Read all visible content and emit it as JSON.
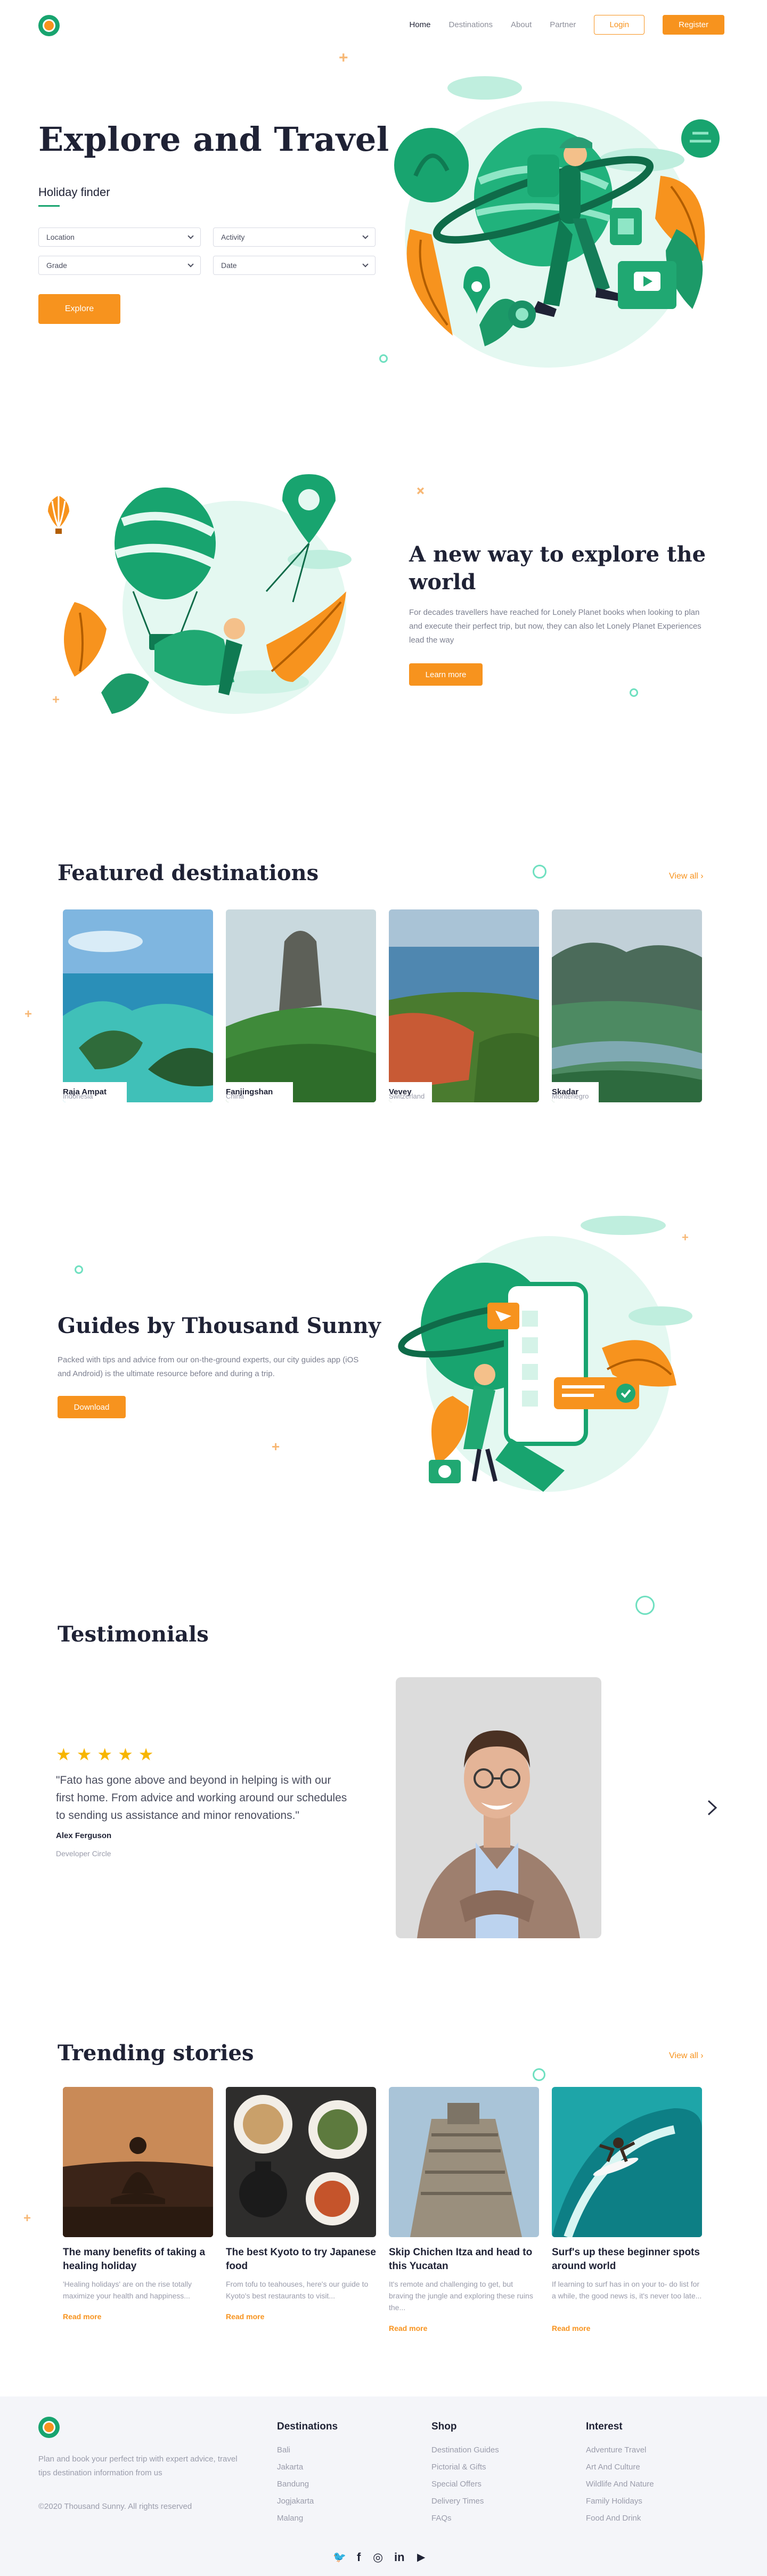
{
  "nav": {
    "items": [
      "Home",
      "Destinations",
      "About",
      "Partner"
    ],
    "login": "Login",
    "register": "Register"
  },
  "hero": {
    "title": "Explore and Travel",
    "finder_title": "Holiday finder",
    "selects": [
      "Location",
      "Activity",
      "Grade",
      "Date"
    ],
    "explore": "Explore"
  },
  "about": {
    "title": "A new way to explore the world",
    "text": "For decades travellers have reached for Lonely Planet books when looking to plan and execute their perfect trip, but now, they can also let Lonely Planet Experiences lead the way",
    "button": "Learn more"
  },
  "featured": {
    "title": "Featured destinations",
    "view_all": "View all",
    "items": [
      {
        "name": "Raja Ampat",
        "country": "Indonesia"
      },
      {
        "name": "Fanjingshan",
        "country": "China"
      },
      {
        "name": "Vevey",
        "country": "Switzerland"
      },
      {
        "name": "Skadar",
        "country": "Montenegro"
      }
    ]
  },
  "guides": {
    "title": "Guides by Thousand Sunny",
    "text": "Packed with tips and advice from our on-the-ground experts, our city guides app (iOS and Android) is the ultimate resource before and during a trip.",
    "button": "Download"
  },
  "testimonials": {
    "title": "Testimonials",
    "rating": 5,
    "quote": "\"Fato has gone above and beyond in helping is with our first home. From advice and working around our schedules to sending us assistance and minor renovations.\"",
    "author": "Alex Ferguson",
    "role": "Developer Circle"
  },
  "trending": {
    "title": "Trending stories",
    "view_all": "View all",
    "read_more": "Read more",
    "items": [
      {
        "title": "The many benefits of taking a healing holiday",
        "text": "'Healing holidays' are on the rise totally maximize your health and happiness..."
      },
      {
        "title": "The best Kyoto to try Japanese food",
        "text": "From tofu to teahouses, here's our guide to Kyoto's best restaurants to visit..."
      },
      {
        "title": "Skip Chichen Itza and head to this Yucatan",
        "text": "It's remote and challenging to get, but braving the jungle and exploring these ruins the..."
      },
      {
        "title": "Surf's up these beginner spots around world",
        "text": "If learning to surf has in on your to- do list for a while, the good news is, it's never too late..."
      }
    ]
  },
  "footer": {
    "about": "Plan and book your perfect trip with expert advice, travel tips destination information from us",
    "copyright": "©2020 Thousand Sunny. All rights reserved",
    "columns": [
      {
        "title": "Destinations",
        "links": [
          "Bali",
          "Jakarta",
          "Bandung",
          "Jogjakarta",
          "Malang"
        ]
      },
      {
        "title": "Shop",
        "links": [
          "Destination Guides",
          "Pictorial & Gifts",
          "Special Offers",
          "Delivery Times",
          "FAQs"
        ]
      },
      {
        "title": "Interest",
        "links": [
          "Adventure Travel",
          "Art And Culture",
          "Wildlife And Nature",
          "Family Holidays",
          "Food And Drink"
        ]
      }
    ],
    "social": [
      "twitter-icon",
      "facebook-icon",
      "instagram-icon",
      "linkedin-icon",
      "youtube-icon"
    ],
    "social_glyphs": [
      "🐦",
      "f",
      "◎",
      "in",
      "▶"
    ]
  },
  "colors": {
    "accent": "#f7931e",
    "brand": "#18a46f",
    "dark": "#1f2235"
  }
}
